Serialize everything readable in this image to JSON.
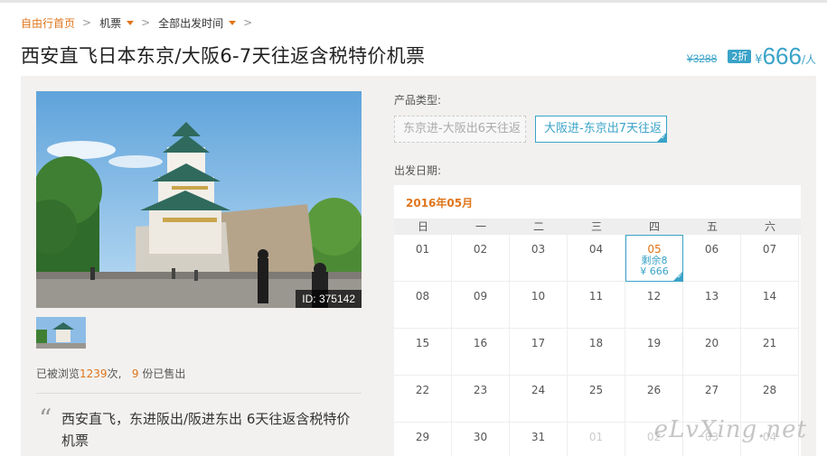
{
  "breadcrumb": {
    "home": "自由行首页",
    "sep": ">",
    "item1": "机票",
    "item2": "全部出发时间"
  },
  "title": "西安直飞日本东京/大阪6-7天往返含税特价机票",
  "price": {
    "original": "¥3288",
    "discount": "2折",
    "currency": "¥",
    "value": "666",
    "unit": "/人"
  },
  "photo": {
    "id_label": "ID: 375142"
  },
  "stats": {
    "views_prefix": "已被浏览",
    "views": "1239",
    "views_suffix": "次,",
    "sold": "9",
    "sold_suffix": "份已售出"
  },
  "description": "西安直飞，东进阪出/阪进东出 6天往返含税特价机票",
  "product_type": {
    "label": "产品类型:",
    "options": [
      {
        "label": "东京进-大阪出6天往返",
        "selected": false
      },
      {
        "label": "大阪进-东京出7天往返",
        "selected": true
      }
    ]
  },
  "departure": {
    "label": "出发日期:",
    "month": "2016年05月",
    "weekdays": [
      "日",
      "一",
      "二",
      "三",
      "四",
      "五",
      "六"
    ],
    "weeks": [
      [
        {
          "d": "01"
        },
        {
          "d": "02"
        },
        {
          "d": "03"
        },
        {
          "d": "04"
        },
        {
          "d": "05",
          "selected": true,
          "stock": "剩余8",
          "price": "¥ 666"
        },
        {
          "d": "06"
        },
        {
          "d": "07"
        }
      ],
      [
        {
          "d": "08"
        },
        {
          "d": "09"
        },
        {
          "d": "10"
        },
        {
          "d": "11"
        },
        {
          "d": "12"
        },
        {
          "d": "13"
        },
        {
          "d": "14"
        }
      ],
      [
        {
          "d": "15"
        },
        {
          "d": "16"
        },
        {
          "d": "17"
        },
        {
          "d": "18"
        },
        {
          "d": "19"
        },
        {
          "d": "20"
        },
        {
          "d": "21"
        }
      ],
      [
        {
          "d": "22"
        },
        {
          "d": "23"
        },
        {
          "d": "24"
        },
        {
          "d": "25"
        },
        {
          "d": "26"
        },
        {
          "d": "27"
        },
        {
          "d": "28"
        }
      ],
      [
        {
          "d": "29"
        },
        {
          "d": "30"
        },
        {
          "d": "31"
        },
        {
          "d": "01",
          "muted": true
        },
        {
          "d": "02",
          "muted": true
        },
        {
          "d": "03",
          "muted": true
        },
        {
          "d": "04",
          "muted": true
        }
      ]
    ]
  },
  "watermark": "eLvXing.net",
  "colors": {
    "accent_orange": "#e0751b",
    "accent_blue": "#3aa3c8",
    "panel_bg": "#f2f1ef"
  }
}
